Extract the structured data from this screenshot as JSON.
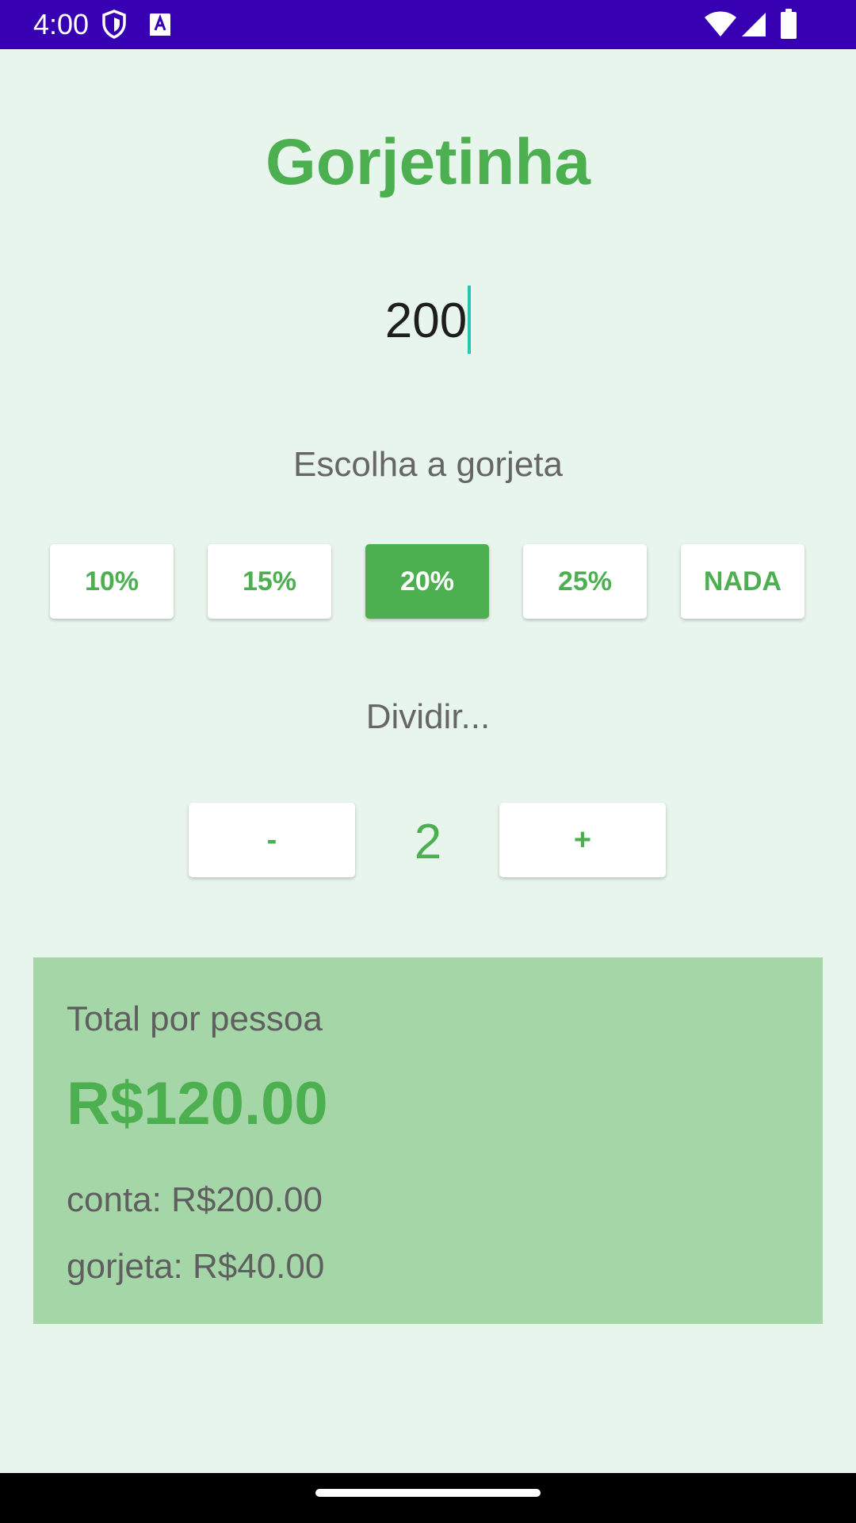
{
  "status_bar": {
    "time": "4:00",
    "icons": [
      "shield-icon",
      "text-a-icon",
      "wifi-icon",
      "signal-icon",
      "battery-icon"
    ],
    "background": "#3700B3"
  },
  "app": {
    "title": "Gorjetinha"
  },
  "bill": {
    "value": "200"
  },
  "tip": {
    "label": "Escolha a gorjeta",
    "options": [
      "10%",
      "15%",
      "20%",
      "25%",
      "NADA"
    ],
    "selected": "20%"
  },
  "split": {
    "label": "Dividir...",
    "minus_label": "-",
    "plus_label": "+",
    "count": "2"
  },
  "result": {
    "label": "Total por pessoa",
    "total": "R$120.00",
    "bill_line": "conta: R$200.00",
    "tip_line": "gorjeta: R$40.00"
  },
  "colors": {
    "accent": "#4CAF50",
    "background": "#E8F5EC",
    "card": "#A5D6A7",
    "caret": "#26C6B0"
  }
}
